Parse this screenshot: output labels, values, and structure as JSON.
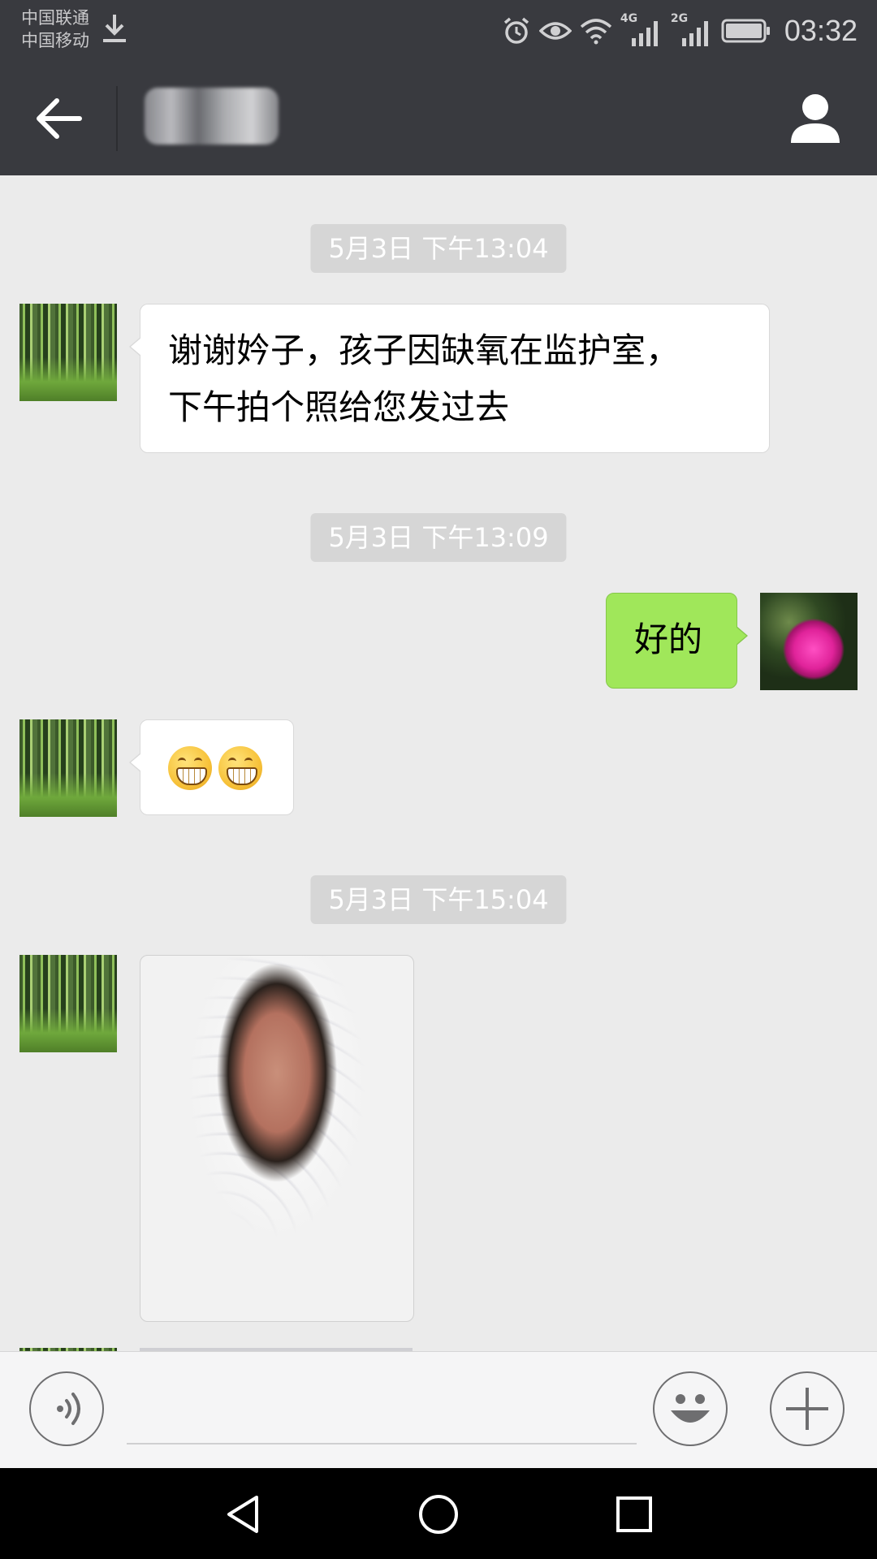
{
  "status_bar": {
    "carrier_1": "中国联通",
    "carrier_2": "中国移动",
    "network_1": "4G",
    "network_2": "2G",
    "time": "03:32",
    "icons": [
      "download-icon",
      "alarm-icon",
      "eye-icon",
      "wifi-icon",
      "signal-icon",
      "signal-icon",
      "battery-icon"
    ]
  },
  "header": {
    "back_icon": "back-arrow-icon",
    "contact_name": "",
    "profile_icon": "person-icon"
  },
  "messages": [
    {
      "type": "timestamp",
      "text": "5月3日 下午13:04"
    },
    {
      "type": "text",
      "side": "left",
      "avatar": "bamboo",
      "lines": [
        "谢谢妗子，孩子因缺氧在监护室，",
        "下午拍个照给您发过去"
      ]
    },
    {
      "type": "timestamp",
      "text": "5月3日 下午13:09"
    },
    {
      "type": "text",
      "side": "right",
      "avatar": "flower",
      "lines": [
        "好的"
      ]
    },
    {
      "type": "emoji",
      "side": "left",
      "avatar": "bamboo",
      "emojis": [
        "grin-emoji",
        "grin-emoji"
      ]
    },
    {
      "type": "timestamp",
      "text": "5月3日 下午15:04"
    },
    {
      "type": "image",
      "side": "left",
      "avatar": "bamboo",
      "image": "newborn-baby-photo"
    }
  ],
  "input_bar": {
    "voice_icon": "voice-icon",
    "text_value": "",
    "emoji_icon": "smiley-icon",
    "more_icon": "plus-icon"
  },
  "navigation_bar": {
    "icons": [
      "back-triangle-icon",
      "home-circle-icon",
      "recents-square-icon"
    ]
  }
}
